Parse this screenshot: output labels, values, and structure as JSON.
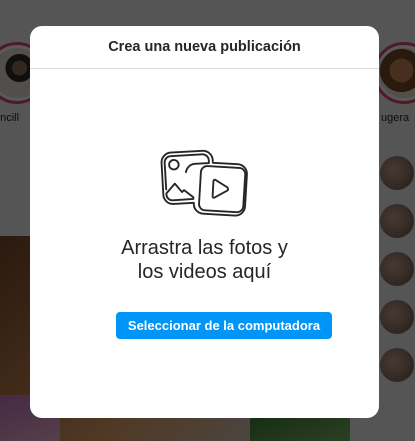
{
  "background": {
    "stories": [
      {
        "name": "encill"
      },
      {
        "name": "ugera"
      }
    ],
    "accent_story_ring": "#e04a6a"
  },
  "modal": {
    "title": "Crea una nueva publicación",
    "drag_line_1": "Arrastra las fotos y",
    "drag_line_2": "los videos aquí",
    "select_button": "Seleccionar de la computadora",
    "button_color": "#0095f6",
    "icon": "photo-video-icon"
  }
}
